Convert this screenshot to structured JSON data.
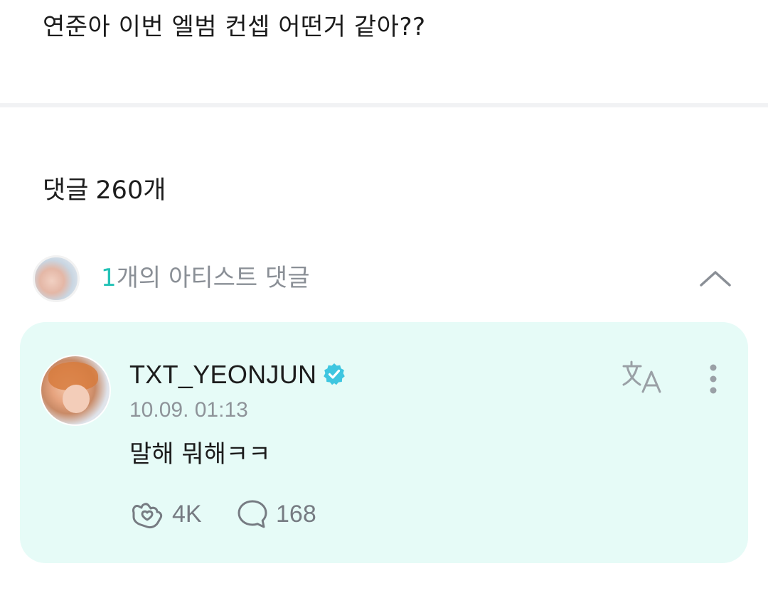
{
  "post": {
    "text": "연준아 이번 엘범 컨셉 어떤거 같아??"
  },
  "comments_header": {
    "label": "댓글",
    "count": "260개"
  },
  "artist_comments": {
    "count": "1",
    "label": "개의 아티스트 댓글",
    "expanded_icon": "chevron-up-icon"
  },
  "comment": {
    "username": "TXT_YEONJUN",
    "verified_icon": "verified-badge-icon",
    "timestamp": "10.09. 01:13",
    "body": "말해 뭐해ㅋㅋ",
    "translate_icon": "translate-icon",
    "more_icon": "more-vertical-icon",
    "like_icon": "heart-hand-icon",
    "likes": "4K",
    "reply_icon": "speech-bubble-icon",
    "replies": "168"
  },
  "colors": {
    "accent": "#23c2b6",
    "card_background": "#e6fbf7",
    "verified": "#3ec6e0",
    "muted_text": "#8e9399"
  }
}
